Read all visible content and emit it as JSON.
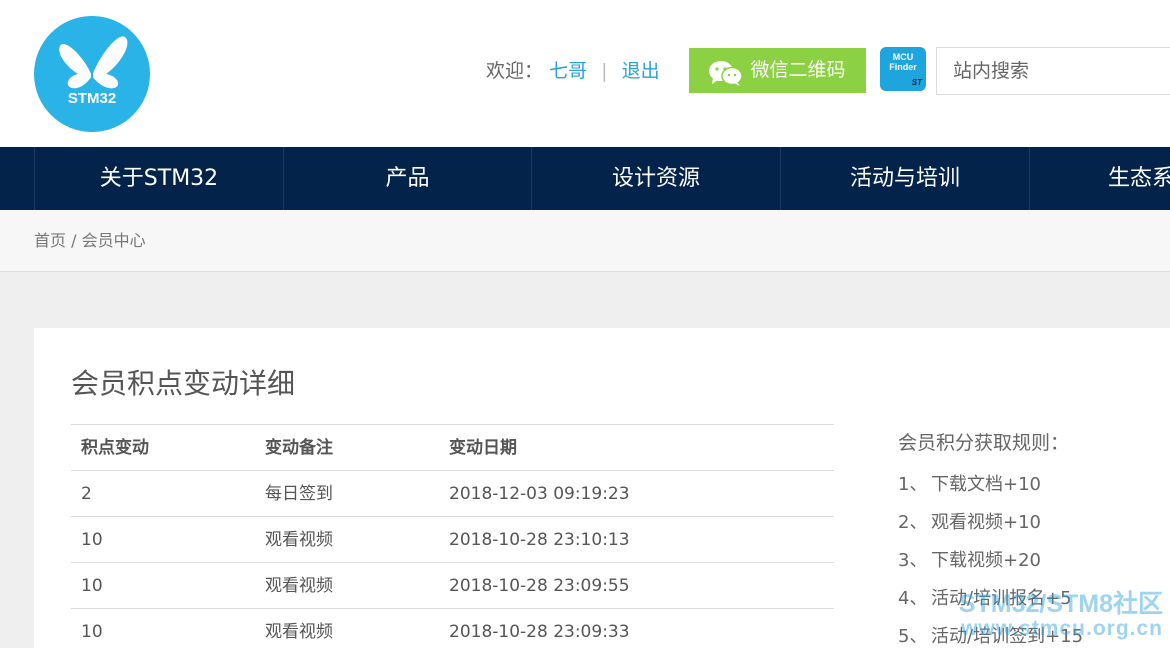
{
  "header": {
    "logo_text": "STM32",
    "welcome_label": "欢迎：",
    "username": "七哥",
    "separator": "|",
    "logout": "退出",
    "wechat_button": "微信二维码",
    "mcu_finder_line1": "MCU",
    "mcu_finder_line2": "Finder",
    "mcu_finder_brand": "ST",
    "search_placeholder": "站内搜索"
  },
  "nav": {
    "items": [
      {
        "label": "关于STM32"
      },
      {
        "label": "产品"
      },
      {
        "label": "设计资源"
      },
      {
        "label": "活动与培训"
      },
      {
        "label": "生态系统"
      }
    ]
  },
  "breadcrumb": {
    "home": "首页",
    "sep": "/",
    "current": "会员中心"
  },
  "main": {
    "title": "会员积点变动详细",
    "table": {
      "headers": [
        "积点变动",
        "变动备注",
        "变动日期"
      ],
      "rows": [
        {
          "points": "2",
          "note": "每日签到",
          "date": "2018-12-03 09:19:23"
        },
        {
          "points": "10",
          "note": "观看视频",
          "date": "2018-10-28 23:10:13"
        },
        {
          "points": "10",
          "note": "观看视频",
          "date": "2018-10-28 23:09:55"
        },
        {
          "points": "10",
          "note": "观看视频",
          "date": "2018-10-28 23:09:33"
        }
      ]
    },
    "rules": {
      "title": "会员积分获取规则：",
      "items": [
        {
          "num": "1、",
          "text": "下载文档+10"
        },
        {
          "num": "2、",
          "text": "观看视频+10"
        },
        {
          "num": "3、",
          "text": "下载视频+20"
        },
        {
          "num": "4、",
          "text": "活动/培训报名+5"
        },
        {
          "num": "5、",
          "text": "活动/培训签到+15"
        }
      ]
    }
  },
  "watermark": {
    "line1": "STM32/STM8社区",
    "line2": "www.stmcu.org.cn"
  },
  "colors": {
    "nav_bg": "#03234b",
    "logo_bg": "#29b3e6",
    "wechat_bg": "#8cd043",
    "link": "#2aa0dc"
  }
}
